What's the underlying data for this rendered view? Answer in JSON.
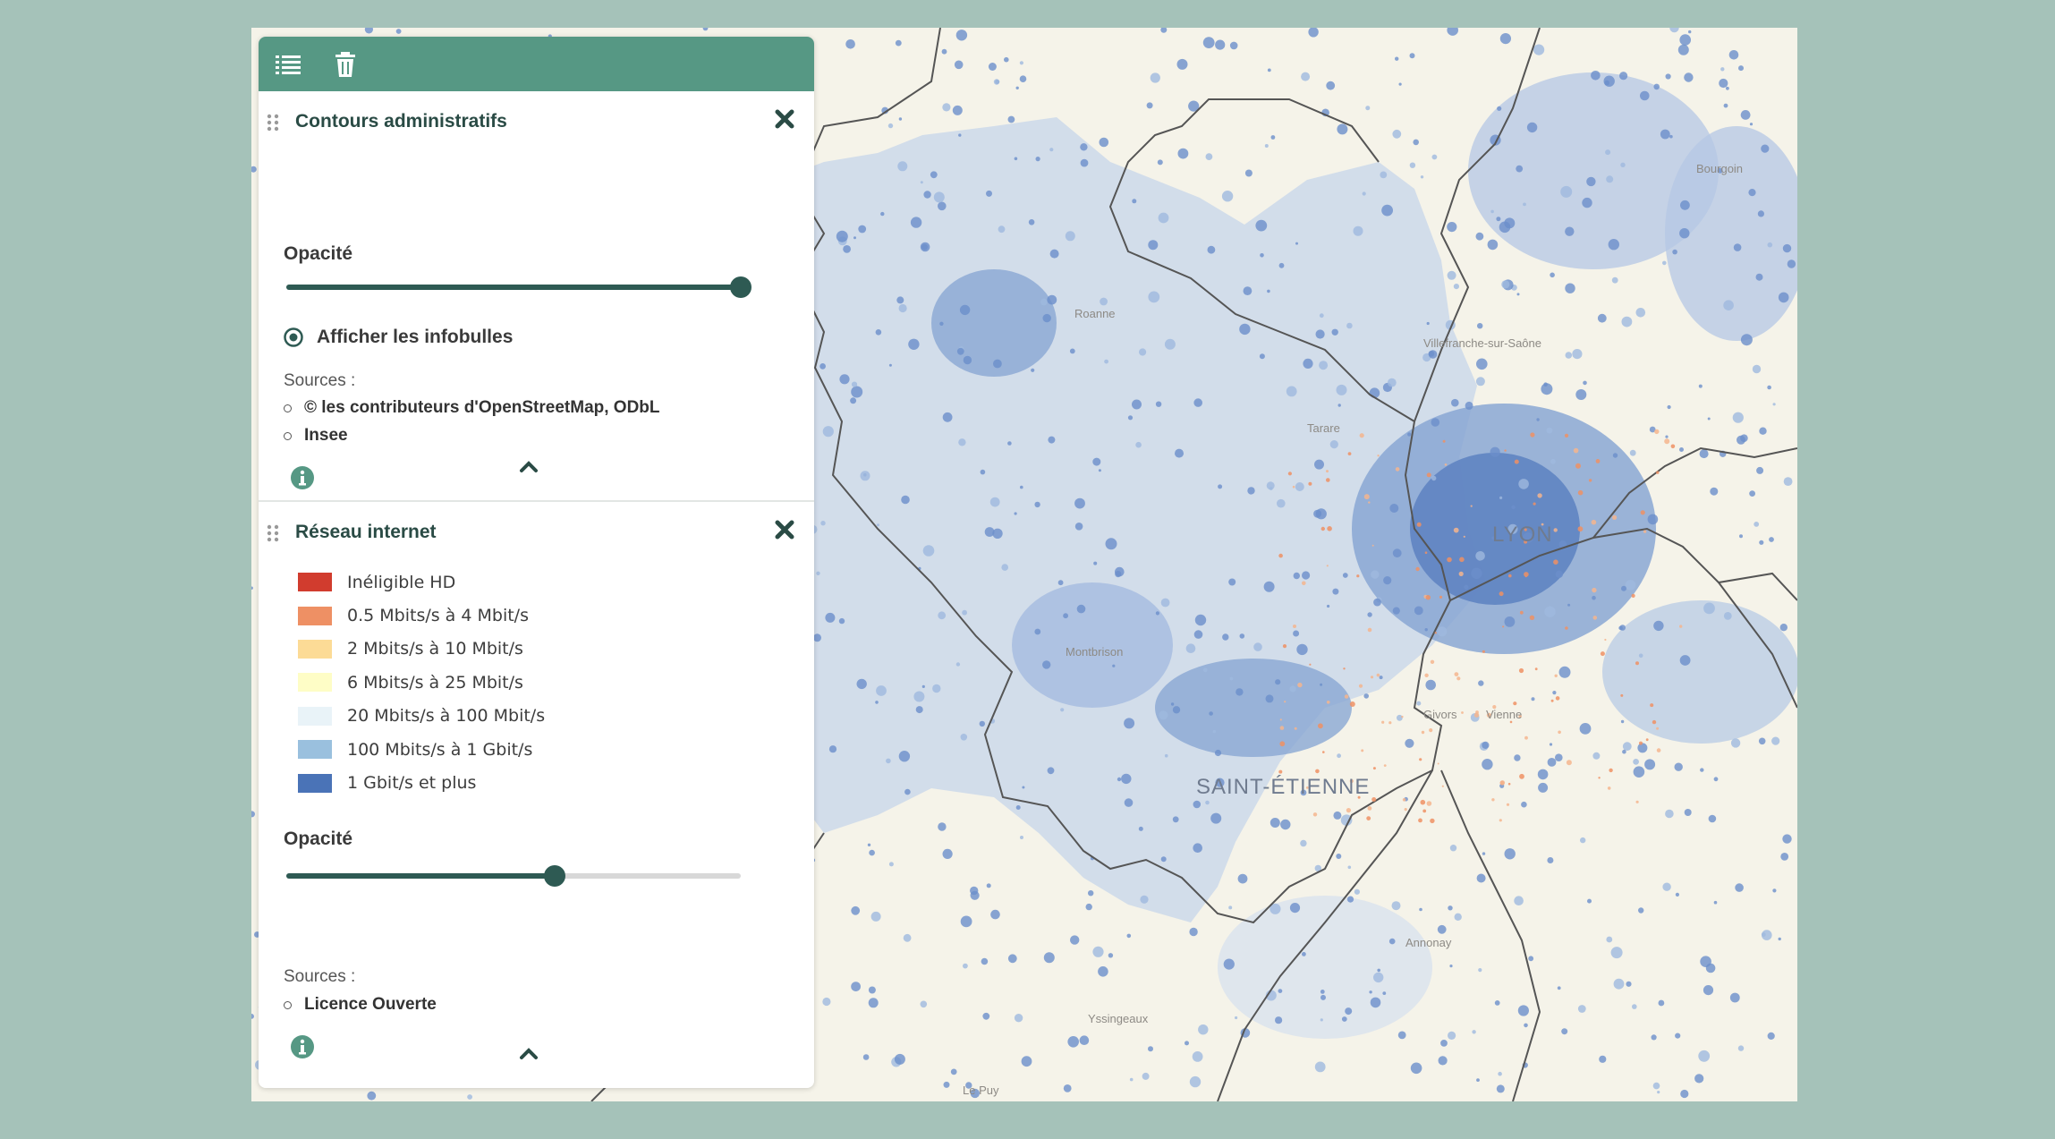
{
  "toolbar": {
    "icons": [
      "list-icon",
      "trash-icon"
    ]
  },
  "layers": [
    {
      "title": "Contours administratifs",
      "opacity_label": "Opacité",
      "opacity": 1.0,
      "tooltips_label": "Afficher les infobulles",
      "sources_label": "Sources :",
      "sources": [
        "© les contributeurs d'OpenStreetMap, ODbL",
        "Insee"
      ]
    },
    {
      "title": "Réseau internet",
      "legend": [
        {
          "label": "Inéligible HD",
          "color": "#d13c2e"
        },
        {
          "label": "0.5 Mbits/s à 4 Mbit/s",
          "color": "#ee9064"
        },
        {
          "label": "2 Mbits/s à 10 Mbit/s",
          "color": "#fcdb96"
        },
        {
          "label": "6 Mbits/s à 25 Mbit/s",
          "color": "#fefdc6"
        },
        {
          "label": "20 Mbits/s à 100 Mbit/s",
          "color": "#e9f3f8"
        },
        {
          "label": "100 Mbits/s à 1 Gbit/s",
          "color": "#9ac0de"
        },
        {
          "label": "1 Gbit/s et plus",
          "color": "#4a73b7"
        }
      ],
      "opacity_label": "Opacité",
      "opacity": 0.59,
      "sources_label": "Sources :",
      "sources": [
        "Licence Ouverte"
      ]
    }
  ],
  "map": {
    "labels": [
      "LYON",
      "SAINT-ÉTIENNE",
      "Villefranche-sur-Saône",
      "Roanne",
      "Tarare",
      "Montbrison",
      "Yssingeaux",
      "Annonay",
      "Vienne",
      "Givors",
      "Bourgoin",
      "Le Puy"
    ]
  },
  "colors": {
    "accent": "#569884",
    "dark": "#2e5a53",
    "background": "#a5c2b9"
  }
}
